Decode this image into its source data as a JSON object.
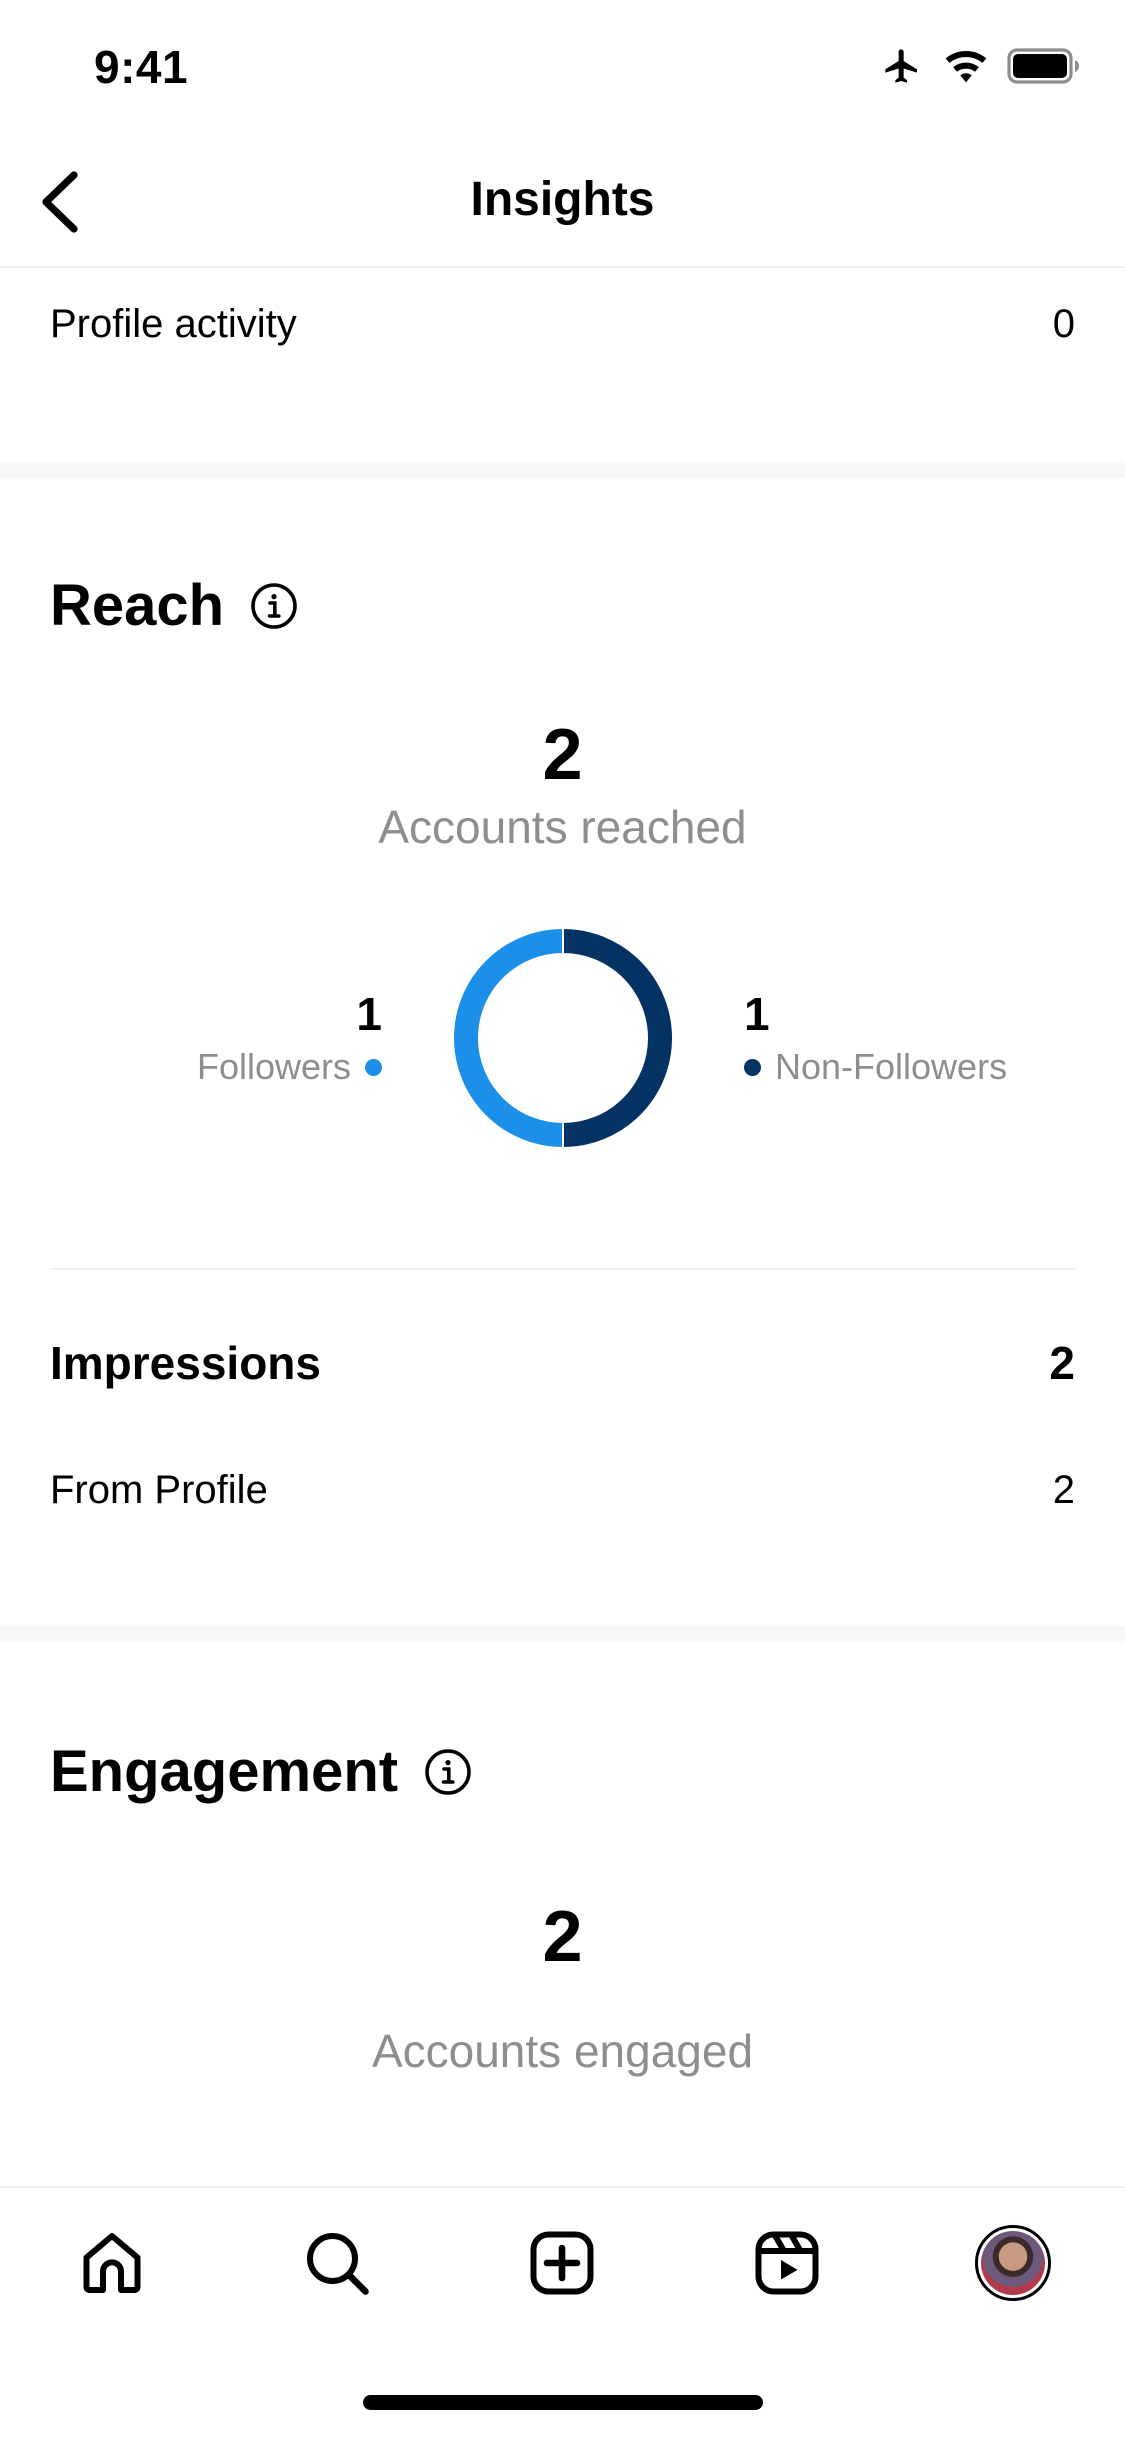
{
  "status_bar": {
    "time": "9:41"
  },
  "nav": {
    "title": "Insights"
  },
  "profile_activity": {
    "label": "Profile activity",
    "value": "0"
  },
  "reach": {
    "title": "Reach",
    "accounts_count": "2",
    "accounts_label": "Accounts reached",
    "followers": {
      "count": "1",
      "label": "Followers",
      "color": "#1c8fe8"
    },
    "non_followers": {
      "count": "1",
      "label": "Non-Followers",
      "color": "#043263"
    }
  },
  "impressions": {
    "label": "Impressions",
    "value": "2",
    "from_profile_label": "From Profile",
    "from_profile_value": "2"
  },
  "engagement": {
    "title": "Engagement",
    "accounts_count": "2",
    "accounts_label": "Accounts engaged"
  },
  "chart_data": {
    "type": "pie",
    "categories": [
      "Followers",
      "Non-Followers"
    ],
    "values": [
      1,
      1
    ],
    "colors": [
      "#1c8fe8",
      "#043263"
    ]
  },
  "tab_bar": {
    "items": [
      "home-icon",
      "search-icon",
      "create-icon",
      "reels-icon",
      "profile-avatar"
    ]
  }
}
